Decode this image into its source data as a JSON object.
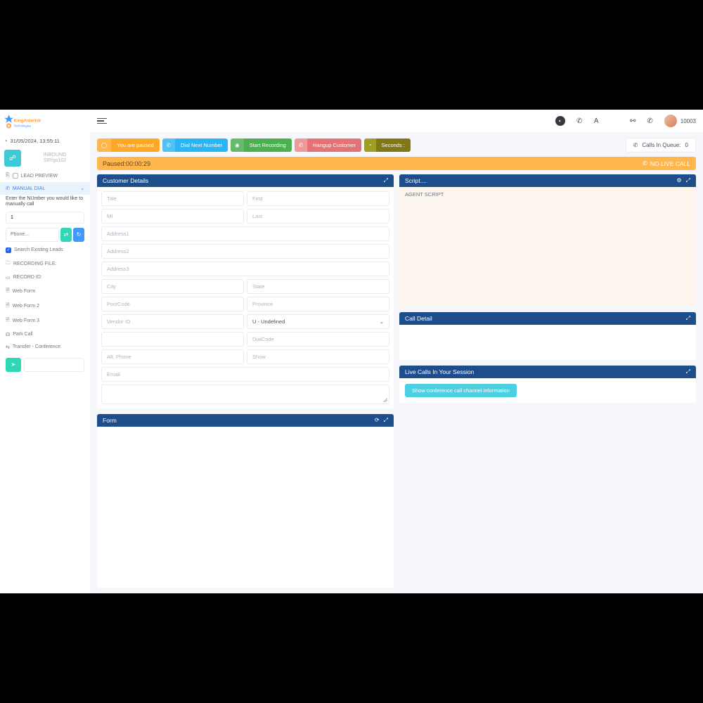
{
  "brand": {
    "name1": "KingAsterisk",
    "name2": "Technologies"
  },
  "datetime": "31/05/2024, 13:55:11",
  "inbound": {
    "label": "INBOUND",
    "sip": "SIP/gs102"
  },
  "sidebar": {
    "lead_preview": "LEAD PREVIEW",
    "manual_dial": "MANUAL DIAL",
    "manual_note": "Enter the NUmber you would like to manually call",
    "country_code_value": "1",
    "phone_placeholder": "Phone...",
    "search_existing": "Search Existing Leads",
    "recording_file": "RECORDING FILE:",
    "record_id": "RECORD ID:",
    "items": [
      {
        "label": "Web Form"
      },
      {
        "label": "Web Form 2"
      },
      {
        "label": "Web Form 3"
      },
      {
        "label": "Park Call"
      },
      {
        "label": "Transfer - Conference"
      }
    ]
  },
  "topbar": {
    "agent_id": "10003"
  },
  "actions": {
    "paused": "You are paused",
    "dial_next": "Dial Next Number",
    "start_rec": "Start Recording",
    "hangup": "Hangup Customer",
    "seconds": "Seconds :"
  },
  "queue": {
    "label": "Calls In Queue:",
    "count": "0"
  },
  "status": {
    "text": "Paused:00:00:29",
    "nolive": "NO LIVE CALL"
  },
  "panels": {
    "customer": {
      "title": "Customer Details",
      "fields": {
        "title": "Title",
        "first": "First",
        "mi": "MI",
        "last": "Last",
        "addr1": "Address1",
        "addr2": "Address2",
        "addr3": "Address3",
        "city": "City",
        "state": "State",
        "postcode": "PostCode",
        "province": "Province",
        "vendor": "Vendor ID",
        "gender": "U - Undefined",
        "dialcode": "DialCode",
        "altphone": "Alt. Phone",
        "show": "Show",
        "email": "Email"
      }
    },
    "script": {
      "title": "Script....",
      "body": "AGENT SCRIPT"
    },
    "form": {
      "title": "Form"
    },
    "calldetail": {
      "title": "Call Detail"
    },
    "livecalls": {
      "title": "Live Calls In Your Session",
      "conf_btn": "Show conference call channel information"
    }
  }
}
